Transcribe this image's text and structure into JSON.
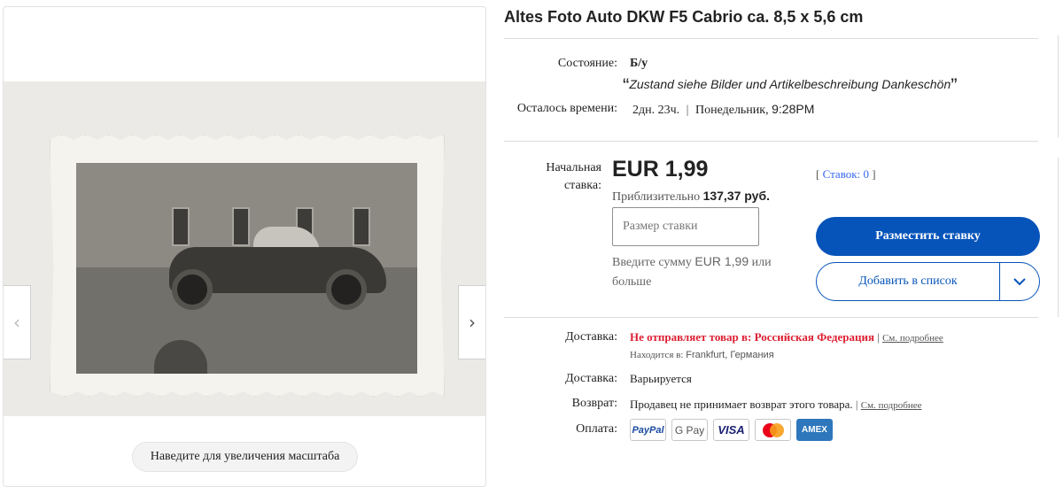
{
  "gallery": {
    "zoom_hint": "Наведите для увеличения масштаба",
    "prev_arrow": "‹",
    "next_arrow": "›"
  },
  "listing": {
    "title": "Altes Foto Auto DKW F5 Cabrio ca. 8,5 x 5,6 cm"
  },
  "condition": {
    "label": "Состояние:",
    "value": "Б/у",
    "note": "Zustand siehe Bilder und Artikelbeschreibung Dankeschön",
    "open_quote": "“",
    "close_quote": "”"
  },
  "time_left": {
    "label": "Осталось времени:",
    "value": "2дн. 23ч.",
    "separator": "|",
    "day": "Понедельник,",
    "clock": "9:28PM"
  },
  "bid": {
    "start_label_1": "Начальная",
    "start_label_2": "ставка:",
    "price": "EUR 1,99",
    "approx_prefix": "Приблизительно",
    "approx_value": "137,37 руб.",
    "bids_open": "[",
    "bids_label": "Ставок:",
    "bids_count": "0",
    "bids_close": "]",
    "input_placeholder": "Размер ставки",
    "help_prefix": "Введите сумму",
    "help_amount": "EUR 1,99",
    "help_suffix": "или больше",
    "place_bid_label": "Разместить ставку",
    "add_to_list_label": "Добавить в список"
  },
  "shipping": {
    "label": "Доставка:",
    "value": "Не отправляет товар в: Российская Федерация",
    "separator": "|",
    "details_link": "См. подробнее",
    "location_label": "Находится в:",
    "location_value": "Frankfurt, Германия"
  },
  "delivery": {
    "label": "Доставка:",
    "value": "Варьируется"
  },
  "returns": {
    "label": "Возврат:",
    "value": "Продавец не принимает возврат этого товара.",
    "separator": "|",
    "details_link": "См. подробнее"
  },
  "payment": {
    "label": "Оплата:",
    "methods": [
      "PayPal",
      "G Pay",
      "VISA",
      "mastercard-icon",
      "AMEX"
    ]
  },
  "colors": {
    "primary_blue": "#0654ba",
    "link_blue": "#3665f3",
    "alert_red": "#dd1e31"
  }
}
